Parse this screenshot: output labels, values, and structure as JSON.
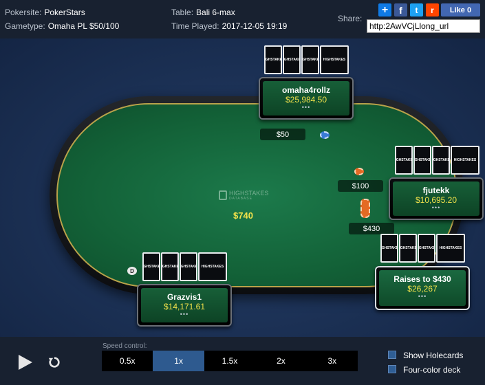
{
  "header": {
    "pokersite_label": "Pokersite:",
    "pokersite_value": "PokerStars",
    "gametype_label": "Gametype:",
    "gametype_value": "Omaha PL $50/100",
    "table_label": "Table:",
    "table_value": "Bali 6-max",
    "time_label": "Time Played:",
    "time_value": "2017-12-05 19:19",
    "share_label": "Share:",
    "share_url": "http:2AwVCjLlong_url",
    "social": {
      "addthis": "+",
      "facebook": "f",
      "twitter": "t",
      "reddit": "r",
      "like": "Like 0"
    }
  },
  "table": {
    "logo_text": "HIGHSTAKES",
    "logo_sub": "DATABASE",
    "pot": "$740",
    "card_back_text": "HIGHSTAKES",
    "dealer_button": "D"
  },
  "players": [
    {
      "name": "omaha4rollz",
      "stack": "$25,984.50",
      "dots": "•••",
      "bet": "$50"
    },
    {
      "name": "fjutekk",
      "stack": "$10,695.20",
      "dots": "•••",
      "bet": "$100"
    },
    {
      "name": "Raises to $430",
      "stack": "$26,267",
      "dots": "•••",
      "bet": "$430"
    },
    {
      "name": "Grazvis1",
      "stack": "$14,171.61",
      "dots": "•••"
    }
  ],
  "controls": {
    "speed_label": "Speed control:",
    "speeds": [
      "0.5x",
      "1x",
      "1.5x",
      "2x",
      "3x"
    ],
    "selected_speed": "1x",
    "show_holecards": "Show Holecards",
    "four_color": "Four-color deck",
    "play_icon": "play-icon",
    "replay_icon": "replay-icon"
  },
  "colors": {
    "accent": "#2e5a8f",
    "stack": "#f1e24b",
    "felt": "#136238"
  }
}
